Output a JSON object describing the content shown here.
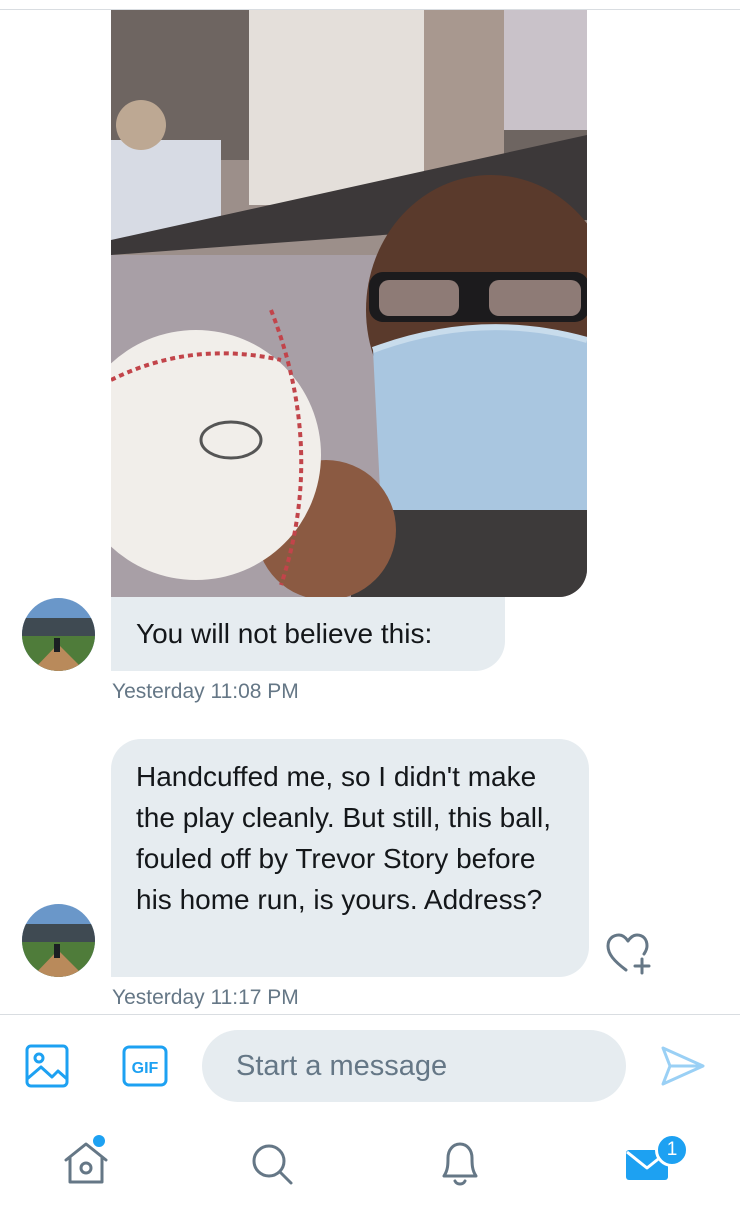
{
  "conversation": {
    "messages": [
      {
        "type": "image",
        "text": "You will not believe this:",
        "timestamp": "Yesterday 11:08 PM"
      },
      {
        "type": "text",
        "text": "Handcuffed me, so I didn't make the play cleanly. But still, this ball, fouled off by Trevor Story before his home run, is yours. Address?",
        "timestamp": "Yesterday 11:17 PM"
      }
    ]
  },
  "composer": {
    "placeholder": "Start a message",
    "gif_label": "GIF"
  },
  "tabbar": {
    "items": [
      "home-icon",
      "search-icon",
      "notifications-icon",
      "messages-icon"
    ],
    "messages_badge": "1"
  },
  "colors": {
    "accent": "#1da1f2",
    "bubble": "#e6ecf0",
    "muted_text": "#657786"
  }
}
